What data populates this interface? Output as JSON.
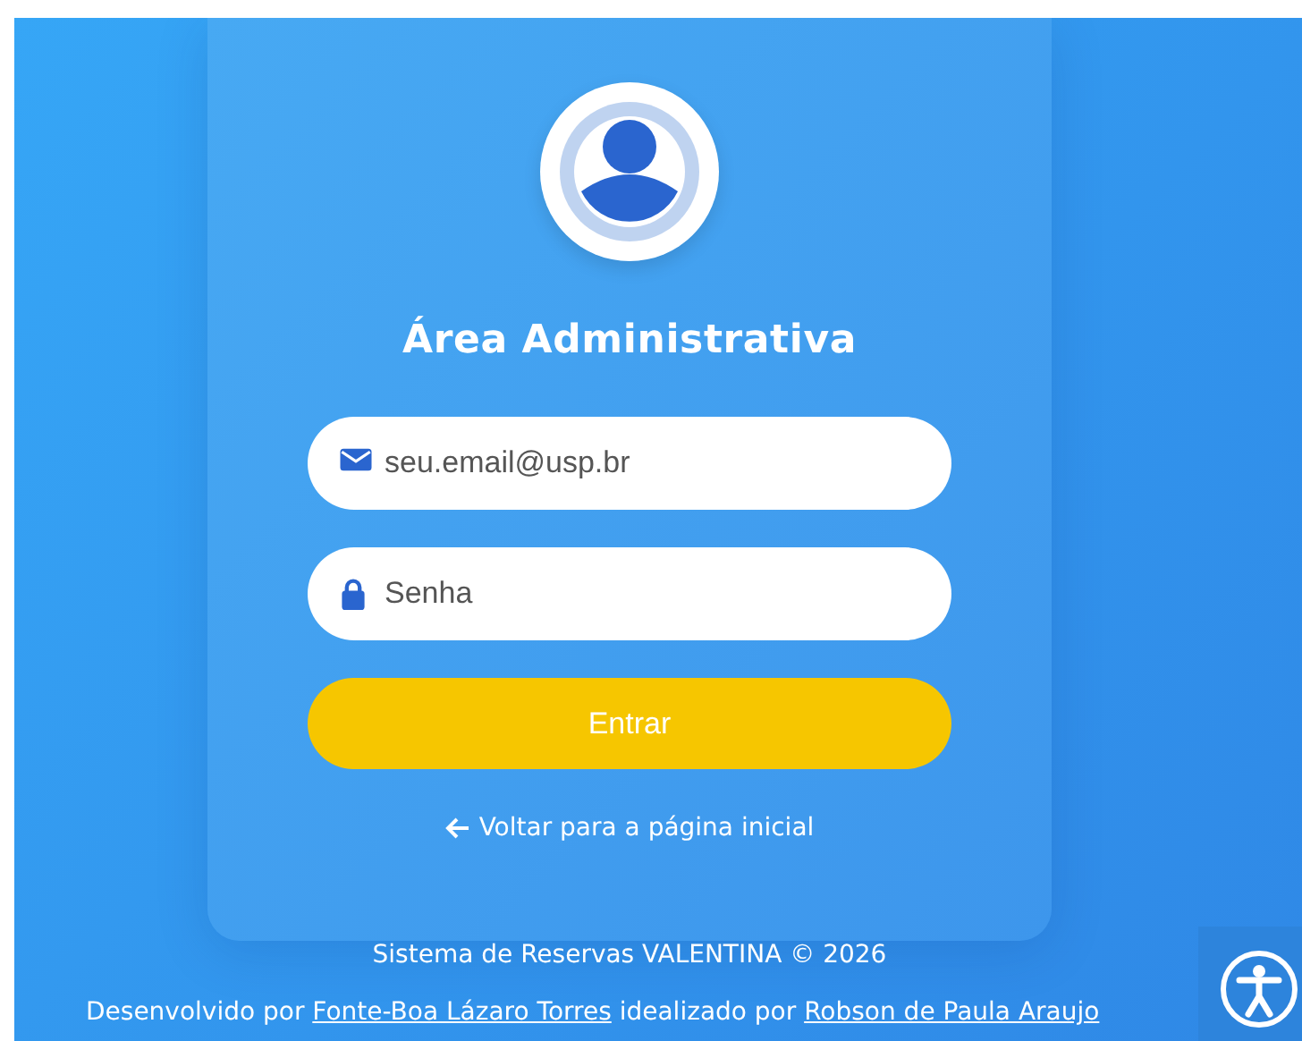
{
  "card": {
    "title": "Área Administrativa"
  },
  "fields": [
    {
      "kind": "email",
      "placeholder": "seu.email@usp.br"
    },
    {
      "kind": "password",
      "placeholder": "Senha"
    }
  ],
  "submit": {
    "label": "Entrar"
  },
  "back_link": {
    "label": "Voltar para a página inicial"
  },
  "footer": {
    "copyright": "Sistema de Reservas VALENTINA © 2026",
    "credits": [
      {
        "kind": "text",
        "text": "Desenvolvido por "
      },
      {
        "kind": "link",
        "text": "Fonte-Boa Lázaro Torres"
      },
      {
        "kind": "text",
        "text": " idealizado por "
      },
      {
        "kind": "link",
        "text": "Robson de Paula Araujo"
      }
    ]
  }
}
